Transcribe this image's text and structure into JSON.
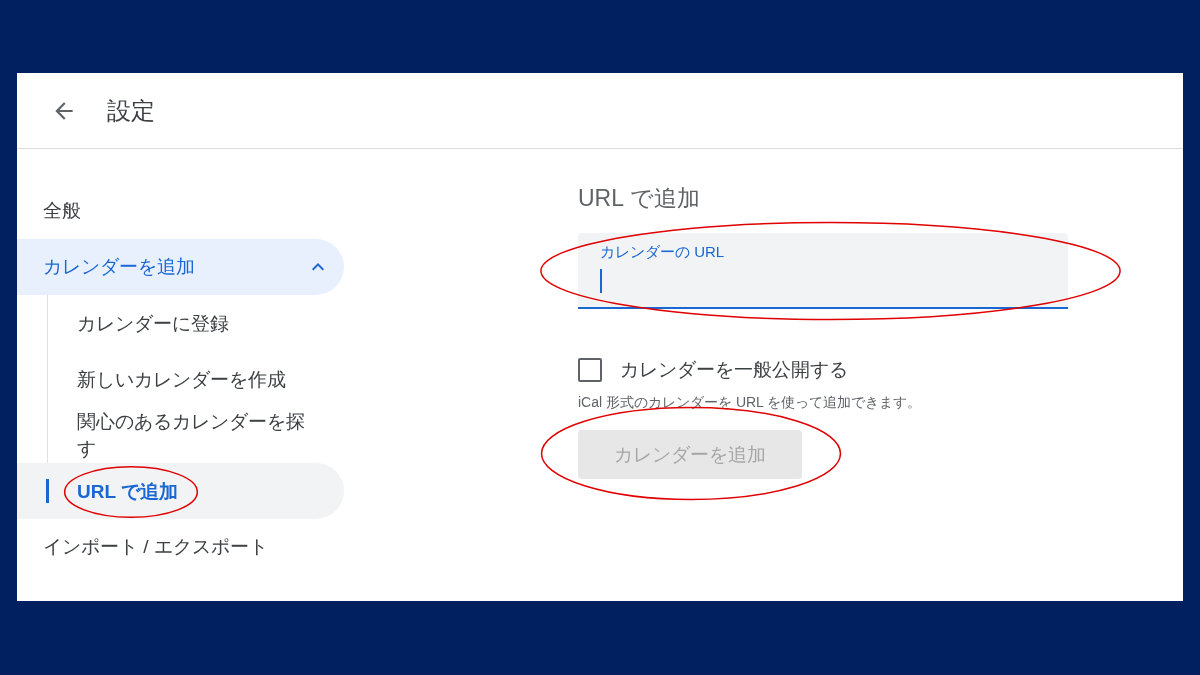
{
  "header": {
    "title": "設定"
  },
  "sidebar": {
    "items": [
      {
        "label": "全般",
        "selected": false
      },
      {
        "label": "カレンダーを追加",
        "selected": true,
        "expanded": true,
        "children": [
          {
            "label": "カレンダーに登録",
            "selected": false,
            "circled": false
          },
          {
            "label": "新しいカレンダーを作成",
            "selected": false,
            "circled": false
          },
          {
            "label": "関心のあるカレンダーを探す",
            "selected": false,
            "circled": false
          },
          {
            "label": "URL で追加",
            "selected": true,
            "circled": true
          }
        ]
      },
      {
        "label": "インポート / エクスポート",
        "selected": false
      }
    ]
  },
  "content": {
    "heading": "URL で追加",
    "url_field": {
      "label": "カレンダーの URL",
      "focused": true,
      "circled": true
    },
    "public_checkbox": {
      "label": "カレンダーを一般公開する",
      "checked": false
    },
    "help_text": "iCal 形式のカレンダーを URL を使って追加できます。",
    "add_button": {
      "label": "カレンダーを追加",
      "disabled": true,
      "circled": true
    }
  }
}
